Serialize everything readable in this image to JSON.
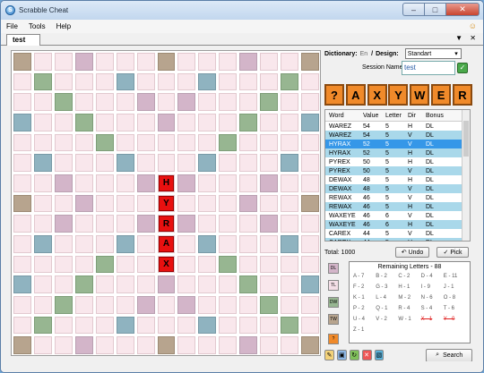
{
  "window": {
    "title": "Scrabble Cheat",
    "app_icon": "S",
    "icon": "app-icon"
  },
  "menu": [
    "File",
    "Tools",
    "Help"
  ],
  "tab": {
    "label": "test",
    "controls": "▼ ✕"
  },
  "board": {
    "tiles": [
      {
        "row": 6,
        "col": 7,
        "letter": "H"
      },
      {
        "row": 7,
        "col": 7,
        "letter": "Y"
      },
      {
        "row": 8,
        "col": 7,
        "letter": "R"
      },
      {
        "row": 9,
        "col": 7,
        "letter": "A"
      },
      {
        "row": 10,
        "col": 7,
        "letter": "X"
      }
    ]
  },
  "panel": {
    "dictionary_label": "Dictionary:",
    "dictionary_value": "En",
    "separator": "/",
    "design_label": "Design:",
    "design_value": "Standart",
    "session_label": "Session Name:",
    "session_value": "test",
    "rack": [
      "?",
      "A",
      "X",
      "Y",
      "W",
      "E",
      "R"
    ],
    "columns": [
      "Word",
      "Value",
      "Letter",
      "Dir",
      "Bonus"
    ],
    "rows": [
      [
        "WAREZ",
        "54",
        "5",
        "H",
        "DL"
      ],
      [
        "WAREZ",
        "54",
        "5",
        "V",
        "DL"
      ],
      [
        "HYRAX",
        "52",
        "5",
        "V",
        "DL"
      ],
      [
        "HYRAX",
        "52",
        "5",
        "H",
        "DL"
      ],
      [
        "PYREX",
        "50",
        "5",
        "H",
        "DL"
      ],
      [
        "PYREX",
        "50",
        "5",
        "V",
        "DL"
      ],
      [
        "DEWAX",
        "48",
        "5",
        "H",
        "DL"
      ],
      [
        "DEWAX",
        "48",
        "5",
        "V",
        "DL"
      ],
      [
        "REWAX",
        "46",
        "5",
        "V",
        "DL"
      ],
      [
        "REWAX",
        "46",
        "5",
        "H",
        "DL"
      ],
      [
        "WAXEYE",
        "46",
        "6",
        "V",
        "DL"
      ],
      [
        "WAXEYE",
        "46",
        "6",
        "H",
        "DL"
      ],
      [
        "CAREX",
        "44",
        "5",
        "V",
        "DL"
      ],
      [
        "CAREX",
        "44",
        "5",
        "H",
        "DL"
      ]
    ],
    "selected_row": 2,
    "total_label": "Total: 1000",
    "undo_label": "Undo",
    "pick_label": "Pick",
    "legend": [
      "DL",
      "TL",
      "DW",
      "TW"
    ],
    "remaining_title": "Remaining Letters - 88",
    "remaining": [
      [
        "A - 7",
        false
      ],
      [
        "B - 2",
        false
      ],
      [
        "C - 2",
        false
      ],
      [
        "D - 4",
        false
      ],
      [
        "E - 11",
        false
      ],
      [
        "F - 2",
        false
      ],
      [
        "G - 3",
        false
      ],
      [
        "H - 1",
        false
      ],
      [
        "I - 9",
        false
      ],
      [
        "J - 1",
        false
      ],
      [
        "K - 1",
        false
      ],
      [
        "L - 4",
        false
      ],
      [
        "M - 2",
        false
      ],
      [
        "N - 6",
        false
      ],
      [
        "O - 8",
        false
      ],
      [
        "P - 2",
        false
      ],
      [
        "Q - 1",
        false
      ],
      [
        "R - 4",
        false
      ],
      [
        "S - 4",
        false
      ],
      [
        "T - 6",
        false
      ],
      [
        "U - 4",
        false
      ],
      [
        "V - 2",
        false
      ],
      [
        "W - 1",
        false
      ],
      [
        "X - 1",
        true
      ],
      [
        "Y - 0",
        true
      ],
      [
        "Z - 1",
        false
      ]
    ],
    "search_label": "Search"
  }
}
